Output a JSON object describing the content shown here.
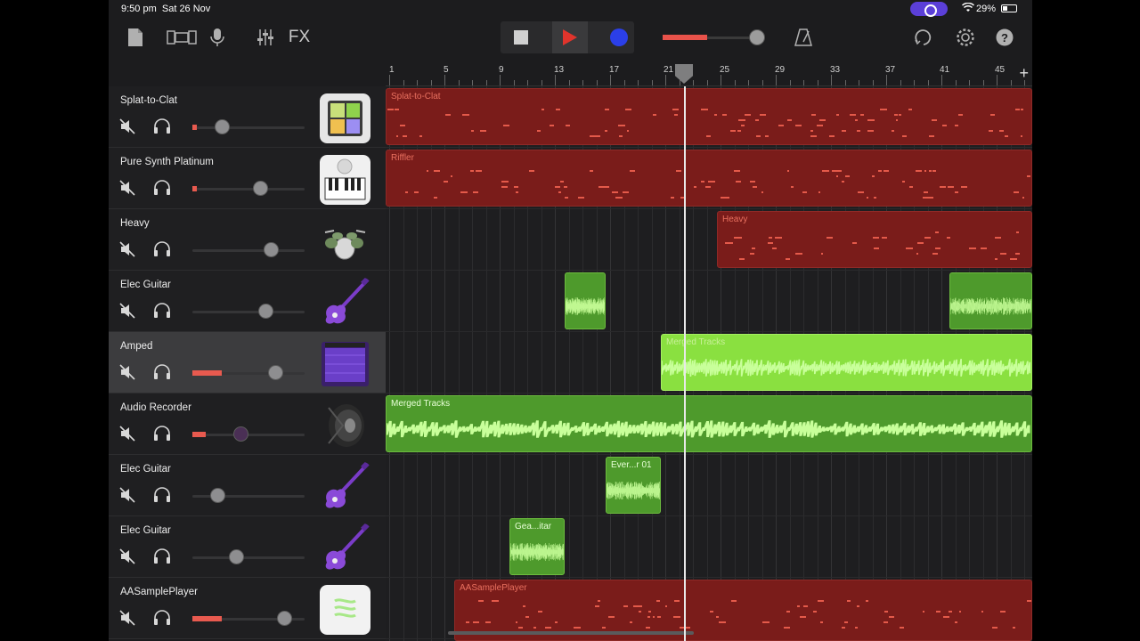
{
  "status": {
    "time": "9:50 pm",
    "date": "Sat 26 Nov",
    "battery": "29%"
  },
  "toolbar": {
    "fx_label": "FX"
  },
  "ruler": {
    "bars": [
      "1",
      "5",
      "9",
      "13",
      "17",
      "21",
      "25",
      "29",
      "33",
      "37",
      "41",
      "45"
    ],
    "add_label": "+"
  },
  "tracks": [
    {
      "name": "Splat-to-Clat",
      "instrument": "drum-pads-icon",
      "volume": 0.26,
      "meter": 0.04
    },
    {
      "name": "Pure Synth Platinum",
      "instrument": "keyboard-icon",
      "volume": 0.6,
      "meter": 0.04
    },
    {
      "name": "Heavy",
      "instrument": "drum-kit-icon",
      "volume": 0.7,
      "meter": 0
    },
    {
      "name": "Elec Guitar",
      "instrument": "electric-guitar-icon",
      "volume": 0.65,
      "meter": 0
    },
    {
      "name": "Amped",
      "instrument": "amplifier-icon",
      "volume": 0.74,
      "meter": 0.26
    },
    {
      "name": "Audio Recorder",
      "instrument": "speaker-icon",
      "volume": 0.43,
      "meter": 0.12
    },
    {
      "name": "Elec Guitar",
      "instrument": "electric-guitar-icon",
      "volume": 0.22,
      "meter": 0
    },
    {
      "name": "Elec Guitar",
      "instrument": "electric-guitar-icon",
      "volume": 0.39,
      "meter": 0
    },
    {
      "name": "AASamplePlayer",
      "instrument": "sample-player-icon",
      "volume": 0.82,
      "meter": 0.26
    }
  ],
  "regions": {
    "splat": "Splat-to-Clat",
    "riffler": "Riffler",
    "heavy": "Heavy",
    "guitar1": "",
    "guitar1b": "",
    "amped": "Merged Tracks",
    "audio": "Merged Tracks",
    "ever": "Ever...r 01",
    "gea": "Gea...itar",
    "sample": "AASamplePlayer"
  },
  "colors": {
    "midi_region": "#7a1c1a",
    "audio_region": "#4e9a2c",
    "record": "#2b3fe8",
    "play": "#e0342c"
  }
}
